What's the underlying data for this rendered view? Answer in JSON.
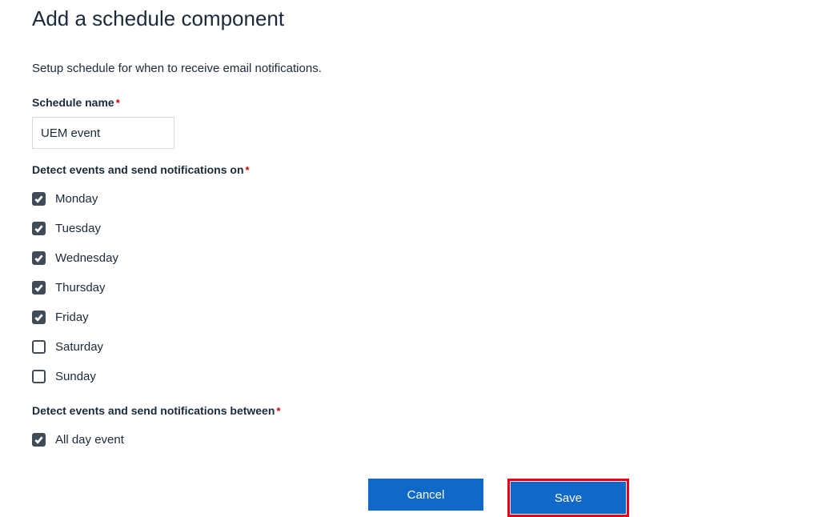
{
  "title": "Add a schedule component",
  "description": "Setup schedule for when to receive email notifications.",
  "schedule_name": {
    "label": "Schedule name",
    "value": "UEM event"
  },
  "days_section": {
    "label": "Detect events and send notifications on",
    "days": [
      {
        "label": "Monday",
        "checked": true
      },
      {
        "label": "Tuesday",
        "checked": true
      },
      {
        "label": "Wednesday",
        "checked": true
      },
      {
        "label": "Thursday",
        "checked": true
      },
      {
        "label": "Friday",
        "checked": true
      },
      {
        "label": "Saturday",
        "checked": false
      },
      {
        "label": "Sunday",
        "checked": false
      }
    ]
  },
  "between_section": {
    "label": "Detect events and send notifications between",
    "all_day": {
      "label": "All day event",
      "checked": true
    }
  },
  "buttons": {
    "cancel": "Cancel",
    "save": "Save"
  },
  "required_marker": "*"
}
